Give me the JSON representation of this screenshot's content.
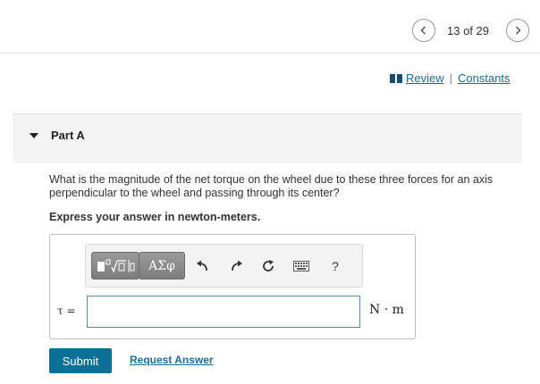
{
  "nav": {
    "counter": "13 of 29",
    "prev_icon": "chevron-left-icon",
    "next_icon": "chevron-right-icon"
  },
  "links": {
    "review": "Review",
    "separator": "|",
    "constants": "Constants",
    "book_icon": "book-icon"
  },
  "part": {
    "title": "Part A",
    "caret_icon": "caret-down-icon"
  },
  "question": {
    "text": "What is the magnitude of the net torque on the wheel due to these three forces for an axis perpendicular to the wheel and passing through its center?",
    "instruction": "Express your answer in newton-meters."
  },
  "toolbar": {
    "templates_icon": "templates-icon",
    "symbols_label": "ΑΣφ",
    "undo_icon": "undo-icon",
    "redo_icon": "redo-icon",
    "reset_icon": "reset-icon",
    "keyboard_icon": "keyboard-icon",
    "help_label": "?"
  },
  "answer": {
    "variable_label": "τ =",
    "value": "",
    "unit": "N · m"
  },
  "actions": {
    "submit_label": "Submit",
    "request_answer_label": "Request Answer"
  },
  "colors": {
    "accent": "#0b6f96",
    "link": "#1a6e96",
    "header_bg": "#f4f4f4"
  }
}
